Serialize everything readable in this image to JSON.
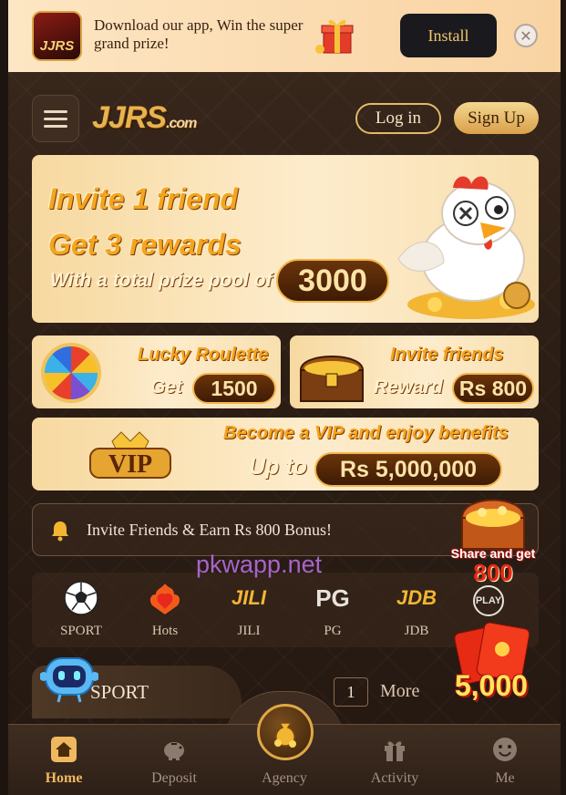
{
  "download_banner": {
    "logo_text": "JJRS",
    "message": "Download our app, Win the super grand prize!",
    "install_label": "Install",
    "close_icon": "close-icon"
  },
  "header": {
    "brand": "JJRS",
    "brand_suffix": ".com",
    "login_label": "Log in",
    "signup_label": "Sign Up"
  },
  "promos": {
    "main": {
      "line1": "Invite 1 friend",
      "line2": "Get 3 rewards",
      "line3": "With a total prize pool of",
      "value": "3000"
    },
    "roulette": {
      "title": "Lucky Roulette",
      "label": "Get",
      "value": "1500"
    },
    "invite": {
      "title": "Invite friends",
      "label": "Reward",
      "value": "Rs 800"
    },
    "vip": {
      "title": "Become a VIP and enjoy benefits",
      "label": "Up to",
      "value": "Rs 5,000,000",
      "badge": "VIP"
    }
  },
  "notice": {
    "text": "Invite Friends & Earn Rs 800 Bonus!"
  },
  "watermark": "pkwapp.net",
  "categories": [
    {
      "label": "SPORT",
      "icon": "soccer-ball-icon",
      "logo": ""
    },
    {
      "label": "Hots",
      "icon": "fire-heart-icon",
      "logo": ""
    },
    {
      "label": "JILI",
      "icon": "jili-logo-icon",
      "logo": "JILI"
    },
    {
      "label": "PG",
      "icon": "pg-logo-icon",
      "logo": "PG"
    },
    {
      "label": "JDB",
      "icon": "jdb-logo-icon",
      "logo": "JDB"
    },
    {
      "label": "",
      "icon": "play-logo-icon",
      "logo": "PLAY"
    }
  ],
  "section": {
    "label": "SPORT",
    "page": "1",
    "more_label": "More"
  },
  "floating": {
    "share_text": "Share and get",
    "share_value": "800",
    "envelope_value": "5,000"
  },
  "bottom_nav": [
    {
      "label": "Home",
      "icon": "home-icon"
    },
    {
      "label": "Deposit",
      "icon": "piggy-bank-icon"
    },
    {
      "label": "Agency",
      "icon": "money-bag-icon"
    },
    {
      "label": "Activity",
      "icon": "gift-icon"
    },
    {
      "label": "Me",
      "icon": "smiley-face-icon"
    }
  ],
  "colors": {
    "accent": "#f0b85e",
    "background": "#2b1d14",
    "banner": "#fde6c3"
  }
}
